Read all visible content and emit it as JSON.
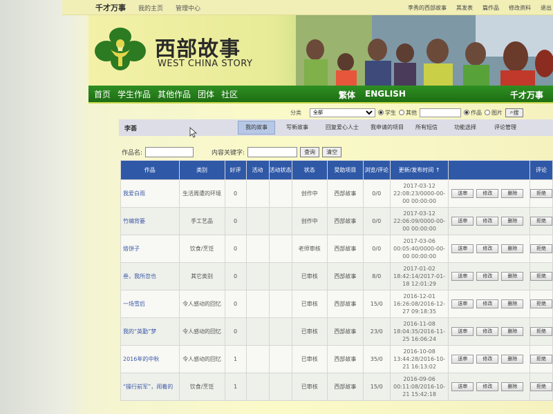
{
  "topbar": {
    "brand": "千才万事",
    "links": [
      "我的主页",
      "管理中心"
    ],
    "right_links": [
      "李秀的西部故事",
      "其发表",
      "篇作品",
      "修改资料",
      "退出"
    ]
  },
  "banner": {
    "logo_cn": "西部故事",
    "logo_en": "WEST CHINA STORY"
  },
  "nav": {
    "items": [
      "首页",
      "学生作品",
      "其他作品",
      "团体",
      "社区"
    ],
    "lang": [
      "繁体",
      "ENGLISH"
    ],
    "right": "千才万事"
  },
  "filter": {
    "category_label": "分类",
    "category_value": "全部",
    "radio_student": "学生",
    "radio_other": "其他",
    "radio_works": "作品",
    "radio_pics": "图片",
    "search_btn": "搜"
  },
  "tabs": {
    "section": "李荟",
    "items": [
      "我的故事",
      "写新故事",
      "回复爱心人士",
      "我申请的项目",
      "所有短信",
      "功能选择",
      "评论管理"
    ]
  },
  "search": {
    "name_label": "作品名:",
    "keyword_label": "内容关键字:",
    "query_btn": "查询",
    "clear_btn": "清空"
  },
  "table": {
    "headers": [
      "作品",
      "类别",
      "好评",
      "活动",
      "活动状态",
      "状态",
      "受助项目",
      "浏览/评论",
      "更新/发布时间 ↑",
      "",
      "评论"
    ],
    "buttons": [
      "送审",
      "修改",
      "删除",
      "拒绝"
    ],
    "rows": [
      {
        "title": "我爱白雨",
        "category": "生活周遭的环境",
        "likes": "0",
        "activity": "",
        "activity_status": "",
        "status": "创作中",
        "project": "西部故事",
        "views": "0/0",
        "time": "2017-03-12 22:08:23/0000-00-00 00:00:00"
      },
      {
        "title": "竹编背篓",
        "category": "手工艺品",
        "likes": "0",
        "activity": "",
        "activity_status": "",
        "status": "创作中",
        "project": "西部故事",
        "views": "0/0",
        "time": "2017-03-12 22:06:09/0000-00-00 00:00:00"
      },
      {
        "title": "烙饼子",
        "category": "饮食/烹饪",
        "likes": "0",
        "activity": "",
        "activity_status": "",
        "status": "老师审核",
        "project": "西部故事",
        "views": "0/0",
        "time": "2017-03-06 00:05:40/0000-00-00 00:00:00"
      },
      {
        "title": "叁，我所忽也",
        "category": "其它类别",
        "likes": "0",
        "activity": "",
        "activity_status": "",
        "status": "已审核",
        "project": "西部故事",
        "views": "8/0",
        "time": "2017-01-02 18:42:14/2017-01-18 12:01:29"
      },
      {
        "title": "一场雪后",
        "category": "令人感动的回忆",
        "likes": "0",
        "activity": "",
        "activity_status": "",
        "status": "已审核",
        "project": "西部故事",
        "views": "15/0",
        "time": "2016-12-01 16:26:08/2016-12-27 09:18:35"
      },
      {
        "title": "我的“英勤”梦",
        "category": "令人感动的回忆",
        "likes": "0",
        "activity": "",
        "activity_status": "",
        "status": "已审核",
        "project": "西部故事",
        "views": "23/0",
        "time": "2016-11-08 18:04:35/2016-11-25 16:06:24"
      },
      {
        "title": "2016年的中秋",
        "category": "令人感动的回忆",
        "likes": "1",
        "activity": "",
        "activity_status": "",
        "status": "已审核",
        "project": "西部故事",
        "views": "35/0",
        "time": "2016-10-08 13:44:28/2016-10-21 16:13:02"
      },
      {
        "title": "“操行前军”，闹着的",
        "category": "饮食/烹饪",
        "likes": "1",
        "activity": "",
        "activity_status": "",
        "status": "已审核",
        "project": "西部故事",
        "views": "15/0",
        "time": "2016-09-06 00:11:08/2016-10-21 15:42:18"
      }
    ]
  }
}
